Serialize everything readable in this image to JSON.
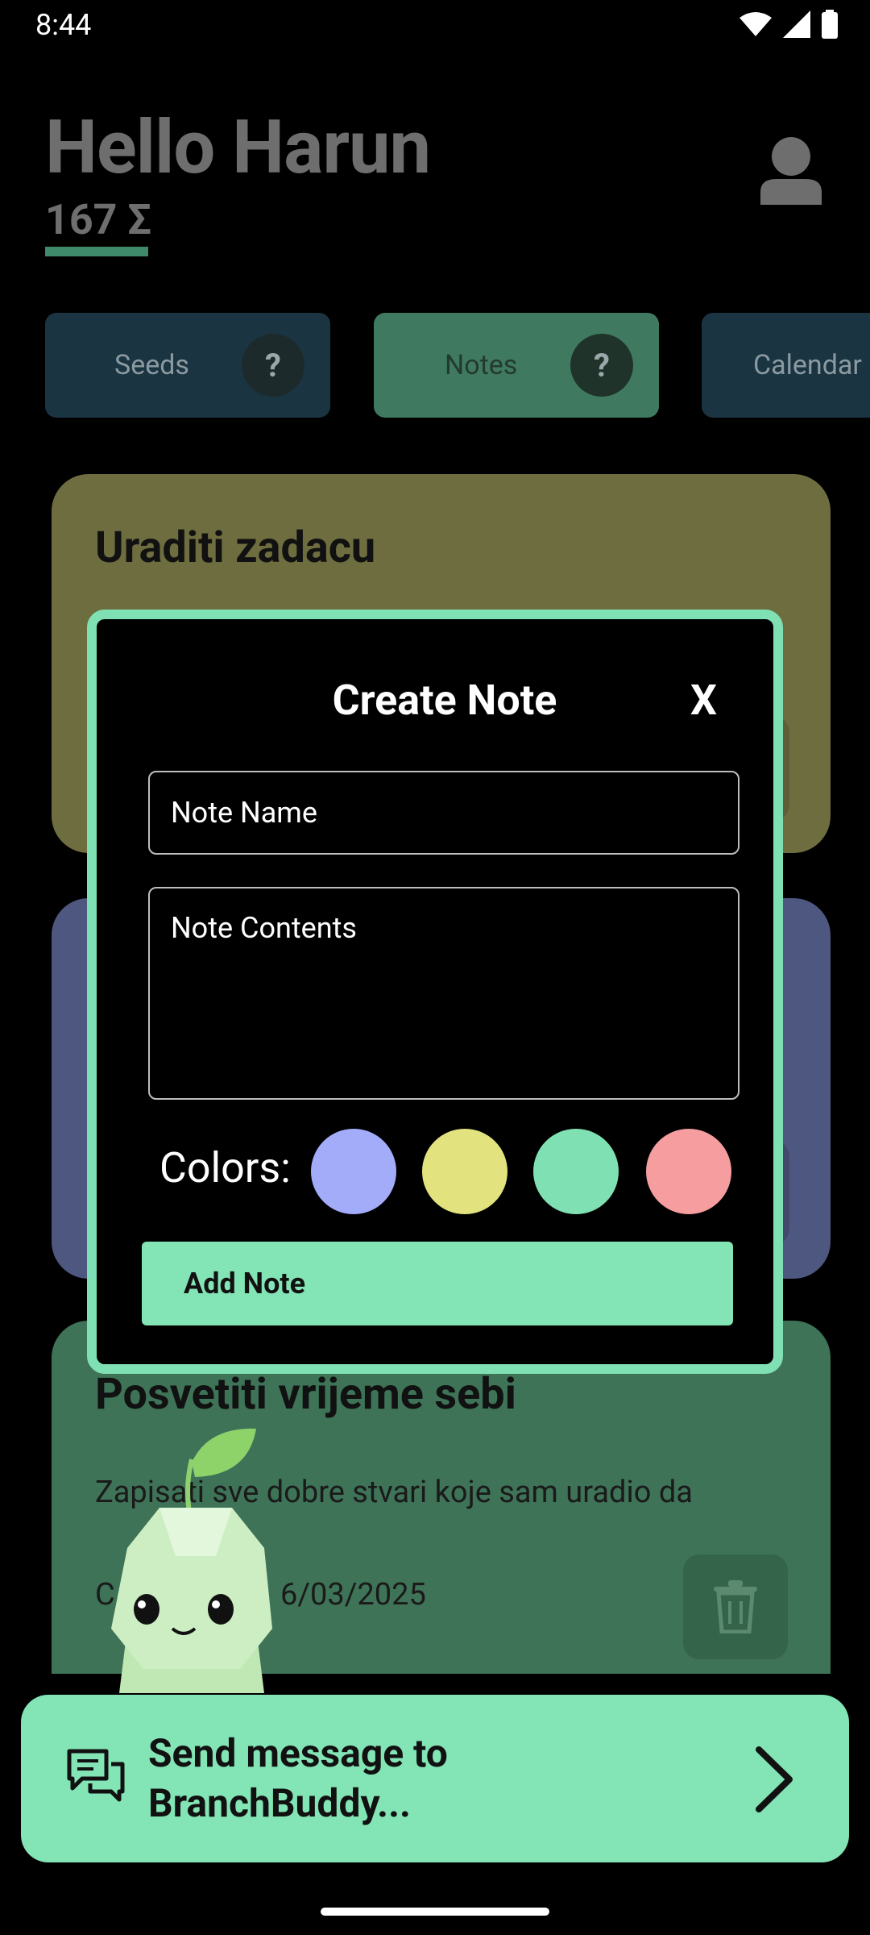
{
  "status_bar": {
    "time": "8:44",
    "icons": [
      "wifi-icon",
      "signal-icon",
      "battery-icon"
    ]
  },
  "header": {
    "greeting": "Hello Harun",
    "points": "167 Σ"
  },
  "tabs": [
    {
      "label": "Seeds",
      "help": "?"
    },
    {
      "label": "Notes",
      "help": "?"
    },
    {
      "label": "Calendar"
    }
  ],
  "cards": [
    {
      "title": "Uraditi zadacu",
      "color": "#6e6d3f"
    },
    {
      "color": "#4e577f"
    },
    {
      "title": "Posvetiti vrijeme sebi",
      "body": "Zapisati sve dobre stvari koje sam uradio da",
      "date_prefix": "C",
      "date_suffix": "6/03/2025",
      "color": "#3e7357"
    }
  ],
  "modal": {
    "title": "Create Note",
    "close_label": "X",
    "name_placeholder": "Note Name",
    "contents_placeholder": "Note Contents",
    "colors_label": "Colors:",
    "colors": [
      "#a3acf9",
      "#e2e37e",
      "#7fe0b3",
      "#f59d9f"
    ],
    "add_label": "Add Note"
  },
  "chat_bar": {
    "text": "Send message to BranchBuddy..."
  },
  "colors": {
    "accent": "#83e4b5",
    "modal_border": "#7fe0b3"
  }
}
